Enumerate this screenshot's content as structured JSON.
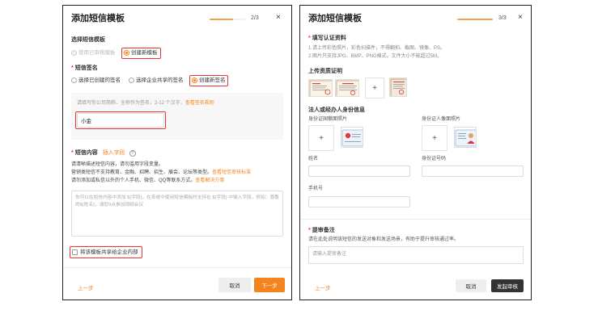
{
  "dialog1": {
    "title": "添加短信模板",
    "step": "2/3",
    "close": "×",
    "progress": 0.66,
    "template_section": {
      "label": "选择短信模板",
      "option_existing": "使用已审核模板",
      "option_new": "创建新模板"
    },
    "sign_section": {
      "label": "短信签名",
      "option_mine": "选择已创建的签名",
      "option_shared": "选择企业共享的签名",
      "option_new": "创建新签名",
      "hint": "请填写你公司简称、全称作为签名，2-12 个汉字，",
      "hint_link": "查看签名规则",
      "value": "小金"
    },
    "content_section": {
      "label": "短信内容",
      "insert_link": "插入字段",
      "help": "?",
      "desc1": "请清晰描述短信内容，请勿滥用字段变量。",
      "desc2": "营销类短信不支持教育、金融、招聘、招生、展会、论坛等类型。",
      "desc2_link": "查看短信审核标准",
      "desc3": "请勿添加或私信以外的个人手机、微信、QQ等联系方式。",
      "desc3_link": "查看解决方案",
      "placeholder": "你可以在短信内容中添加 ${字段}，在系统中使用短信模板时支持在 ${字段} 中输入字段，例如：尊敬的${姓名}，请您9点参加视频会议"
    },
    "share_checkbox": "将该模板共享给企业内部",
    "back": "上一步",
    "cancel": "取消",
    "next": "下一步"
  },
  "dialog2": {
    "title": "添加短信模板",
    "step": "3/3",
    "close": "×",
    "progress": 1.0,
    "cert_section": {
      "label": "填写认证资料",
      "note1": "1.请上传彩色照片，彩色扫描件，不得翻拍、截图、镜像、PS。",
      "note2": "2.图片只支持JPG、BMP、PNG格式，文件大小不能超过5M。"
    },
    "qualification": {
      "label": "上传资质证明",
      "plus": "+"
    },
    "legal": {
      "label": "法人或经办人身份信息",
      "id_front": "身份证国徽面照片",
      "id_portrait": "身份证人像面照片",
      "plus": "+",
      "name_label": "姓名",
      "id_number_label": "身份证号码",
      "phone_label": "手机号"
    },
    "remark": {
      "label": "提审备注",
      "desc": "请在此处说明该短信的发送对象和发送场景，有助于提升审核通过率。",
      "placeholder": "请输入提审备注"
    },
    "back": "上一步",
    "cancel": "取消",
    "submit": "发起审核"
  }
}
